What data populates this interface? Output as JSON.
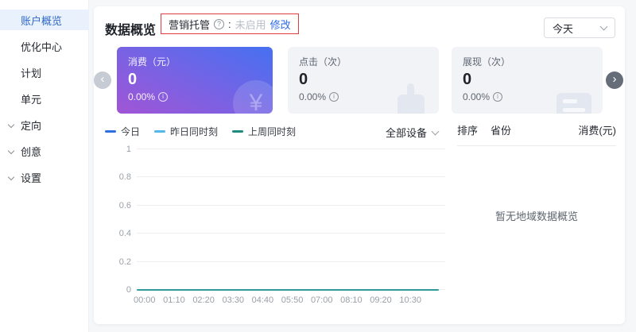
{
  "sidebar": {
    "items": [
      {
        "label": "账户概览",
        "active": true,
        "collapsible": false
      },
      {
        "label": "优化中心",
        "active": false,
        "collapsible": false
      },
      {
        "label": "计划",
        "active": false,
        "collapsible": false
      },
      {
        "label": "单元",
        "active": false,
        "collapsible": false
      },
      {
        "label": "定向",
        "active": false,
        "collapsible": true
      },
      {
        "label": "创意",
        "active": false,
        "collapsible": true
      },
      {
        "label": "设置",
        "active": false,
        "collapsible": true
      }
    ]
  },
  "header": {
    "title": "数据概览",
    "hosting_label": "营销托管",
    "hosting_help_icon": "question-circle",
    "hosting_colon": ":",
    "hosting_status": "未启用",
    "modify_label": "修改"
  },
  "date_filter": {
    "value": "今天"
  },
  "metrics": {
    "cards": [
      {
        "label": "消费（元）",
        "value": "0",
        "change": "0.00%",
        "watermark_icon": "yuan-icon"
      },
      {
        "label": "点击（次）",
        "value": "0",
        "change": "0.00%",
        "watermark_icon": "click-icon"
      },
      {
        "label": "展现（次）",
        "value": "0",
        "change": "0.00%",
        "watermark_icon": "impression-icon"
      }
    ]
  },
  "legend": [
    {
      "label": "今日",
      "color": "#2e6fe0"
    },
    {
      "label": "昨日同时刻",
      "color": "#54b7e8"
    },
    {
      "label": "上周同时刻",
      "color": "#1f8a80"
    }
  ],
  "device_filter": {
    "value": "全部设备"
  },
  "region_panel": {
    "sort_label": "排序",
    "province_label": "省份",
    "metric_label": "消费(元)",
    "empty_text": "暂无地域数据概览"
  },
  "chart_data": {
    "type": "line",
    "title": "数据概览",
    "xlabel": "",
    "ylabel": "",
    "ylim": [
      0,
      1
    ],
    "yticks": [
      0,
      0.2,
      0.4,
      0.6,
      0.8,
      1
    ],
    "grid": true,
    "legend_position": "top-left",
    "x_labels": [
      "00:00",
      "01:10",
      "02:20",
      "03:30",
      "04:40",
      "05:50",
      "07:00",
      "08:10",
      "09:20",
      "10:30"
    ],
    "series": [
      {
        "name": "今日",
        "color": "#2e6fe0",
        "values": [
          0,
          0,
          0,
          0,
          0,
          0,
          0,
          0,
          0,
          0
        ]
      },
      {
        "name": "昨日同时刻",
        "color": "#54b7e8",
        "values": [
          0,
          0,
          0,
          0,
          0,
          0,
          0,
          0,
          0,
          0
        ]
      },
      {
        "name": "上周同时刻",
        "color": "#2f9a99",
        "values": [
          0,
          0,
          0,
          0,
          0,
          0,
          0,
          0,
          0,
          0
        ]
      }
    ]
  },
  "colors": {
    "accent_blue": "#2e6be5",
    "active_item_bg": "#e9f2fc",
    "active_item_text": "#3168c9",
    "alert_red": "#e23c3c",
    "card_gradient_start": "#4a6ff0",
    "card_gradient_end": "#a055d5",
    "muted_text": "#9aa0a8",
    "line_teal": "#2f9a99"
  }
}
